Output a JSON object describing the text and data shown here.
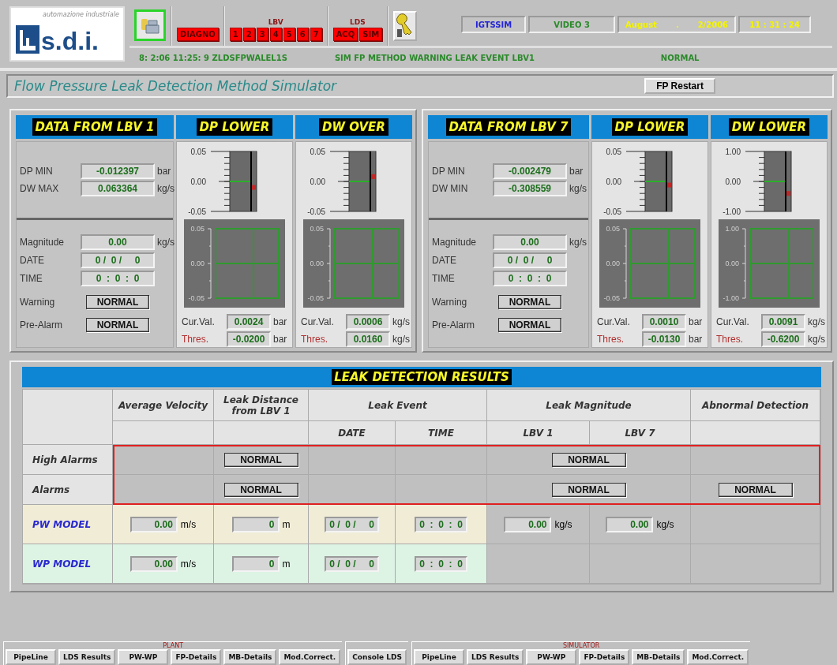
{
  "header": {
    "logo": {
      "tagline": "automazione industriale",
      "name": "s.d.i."
    },
    "button_groups": [
      {
        "buttons": [
          "DIAGNO"
        ]
      },
      {
        "title": "LBV",
        "buttons": [
          "1",
          "2",
          "3",
          "4",
          "5",
          "6",
          "7"
        ]
      },
      {
        "title": "LDS",
        "buttons": [
          "ACQ",
          "SIM"
        ]
      }
    ],
    "info_fields": [
      {
        "texts": [
          "IGTSSIM"
        ],
        "color": "#2323d8"
      },
      {
        "texts": [
          "VIDEO 3"
        ],
        "color": "#2a8a2a"
      },
      {
        "texts": [
          "August",
          ".",
          "2/2006"
        ],
        "color": "#f4f400"
      },
      {
        "texts": [
          "11 : 31 : 24"
        ],
        "color": "#f4f400"
      }
    ],
    "status": [
      "8: 2:06 11:25: 9 ZLDSFPWALEL1S",
      "SIM FP METHOD WARNING LEAK EVENT LBV1",
      "NORMAL"
    ]
  },
  "title_bar": {
    "title": "Flow Pressure Leak Detection Method Simulator",
    "restart_button": "FP Restart"
  },
  "stations": [
    {
      "data": {
        "title": "DATA FROM LBV 1",
        "readings": [
          {
            "label": "DP MIN",
            "value": "-0.012397",
            "unit": "bar"
          },
          {
            "label": "DW MAX",
            "value": "0.063364",
            "unit": "kg/s"
          }
        ],
        "event": [
          {
            "label": "Magnitude",
            "value": "0.00",
            "unit": "kg/s"
          },
          {
            "label": "DATE",
            "value": "0 /  0 /     0"
          },
          {
            "label": "TIME",
            "value": "0  :  0  :  0"
          }
        ],
        "statuses": [
          {
            "label": "Warning",
            "value": "NORMAL"
          },
          {
            "label": "Pre-Alarm",
            "value": "NORMAL"
          }
        ]
      },
      "gauges": [
        {
          "title": "DP LOWER",
          "scale": [
            "0.05",
            "0.00",
            "-0.05"
          ],
          "level": 0.4,
          "trend_ticks": [
            "0.05",
            "0.00",
            "-0.05"
          ],
          "current": {
            "label": "Cur.Val.",
            "value": "0.0024",
            "unit": "bar"
          },
          "threshold": {
            "label": "Thres.",
            "value": "-0.0200",
            "unit": "bar"
          }
        },
        {
          "title": "DW OVER",
          "scale": [
            "0.05",
            "0.00",
            "-0.05"
          ],
          "level": 0.58,
          "trend_ticks": [
            "0.05",
            "0.00",
            "-0.05"
          ],
          "current": {
            "label": "Cur.Val.",
            "value": "0.0006",
            "unit": "kg/s"
          },
          "threshold": {
            "label": "Thres.",
            "value": "0.0160",
            "unit": "kg/s"
          }
        }
      ]
    },
    {
      "data": {
        "title": "DATA FROM LBV 7",
        "readings": [
          {
            "label": "DP MIN",
            "value": "-0.002479",
            "unit": "bar"
          },
          {
            "label": "DW MIN",
            "value": "-0.308559",
            "unit": "kg/s"
          }
        ],
        "event": [
          {
            "label": "Magnitude",
            "value": "0.00",
            "unit": "kg/s"
          },
          {
            "label": "DATE",
            "value": "0 /  0 /     0"
          },
          {
            "label": "TIME",
            "value": "0  :  0  :  0"
          }
        ],
        "statuses": [
          {
            "label": "Warning",
            "value": "NORMAL"
          },
          {
            "label": "Pre-Alarm",
            "value": "NORMAL"
          }
        ]
      },
      "gauges": [
        {
          "title": "DP LOWER",
          "scale": [
            "0.05",
            "0.00",
            "-0.05"
          ],
          "level": 0.44,
          "trend_ticks": [
            "0.05",
            "0.00",
            "-0.05"
          ],
          "current": {
            "label": "Cur.Val.",
            "value": "0.0010",
            "unit": "bar"
          },
          "threshold": {
            "label": "Thres.",
            "value": "-0.0130",
            "unit": "bar"
          }
        },
        {
          "title": "DW LOWER",
          "scale": [
            "1.00",
            "0.00",
            "-1.00"
          ],
          "level": 0.3,
          "trend_ticks": [
            "1.00",
            "0.00",
            "-1.00"
          ],
          "current": {
            "label": "Cur.Val.",
            "value": "0.0091",
            "unit": "kg/s"
          },
          "threshold": {
            "label": "Thres.",
            "value": "-0.6200",
            "unit": "kg/s"
          }
        }
      ]
    }
  ],
  "results": {
    "title": "LEAK DETECTION RESULTS",
    "header_groups": [
      {
        "label": "Average Velocity"
      },
      {
        "label": "Leak Distance from LBV 1"
      },
      {
        "label": "Leak Event",
        "subcolumns": [
          "DATE",
          "TIME"
        ]
      },
      {
        "label": "Leak Magnitude",
        "subcolumns": [
          "LBV 1",
          "LBV 7"
        ]
      },
      {
        "label": "Abnormal Detection"
      }
    ],
    "alarm_rows": [
      {
        "label": "High Alarms",
        "distance": "NORMAL",
        "magnitude": "NORMAL"
      },
      {
        "label": "Alarms",
        "distance": "NORMAL",
        "magnitude": "NORMAL",
        "abnormal": "NORMAL"
      }
    ],
    "model_rows": [
      {
        "label": "PW MODEL",
        "color": "#f1ecd6",
        "velocity": {
          "value": "0.00",
          "unit": "m/s"
        },
        "distance": {
          "value": "0",
          "unit": "m"
        },
        "date": "0 /  0 /     0",
        "time": "0  :  0  :  0",
        "lbv1": {
          "value": "0.00",
          "unit": "kg/s"
        },
        "lbv7": {
          "value": "0.00",
          "unit": "kg/s"
        }
      },
      {
        "label": "WP MODEL",
        "color": "#ddf3e4",
        "velocity": {
          "value": "0.00",
          "unit": "m/s"
        },
        "distance": {
          "value": "0",
          "unit": "m"
        },
        "date": "0 /  0 /     0",
        "time": "0  :  0  :  0"
      }
    ]
  },
  "nav": [
    {
      "title": "PLANT",
      "tabs": [
        "PipeLine",
        "LDS Results",
        "PW-WP",
        "FP-Details",
        "MB-Details",
        "Mod.Correct."
      ]
    },
    {
      "tabs": [
        "Console LDS"
      ]
    },
    {
      "title": "SIMULATOR",
      "tabs": [
        "PipeLine",
        "LDS Results",
        "PW-WP",
        "FP-Details",
        "MB-Details",
        "Mod.Correct."
      ]
    }
  ]
}
